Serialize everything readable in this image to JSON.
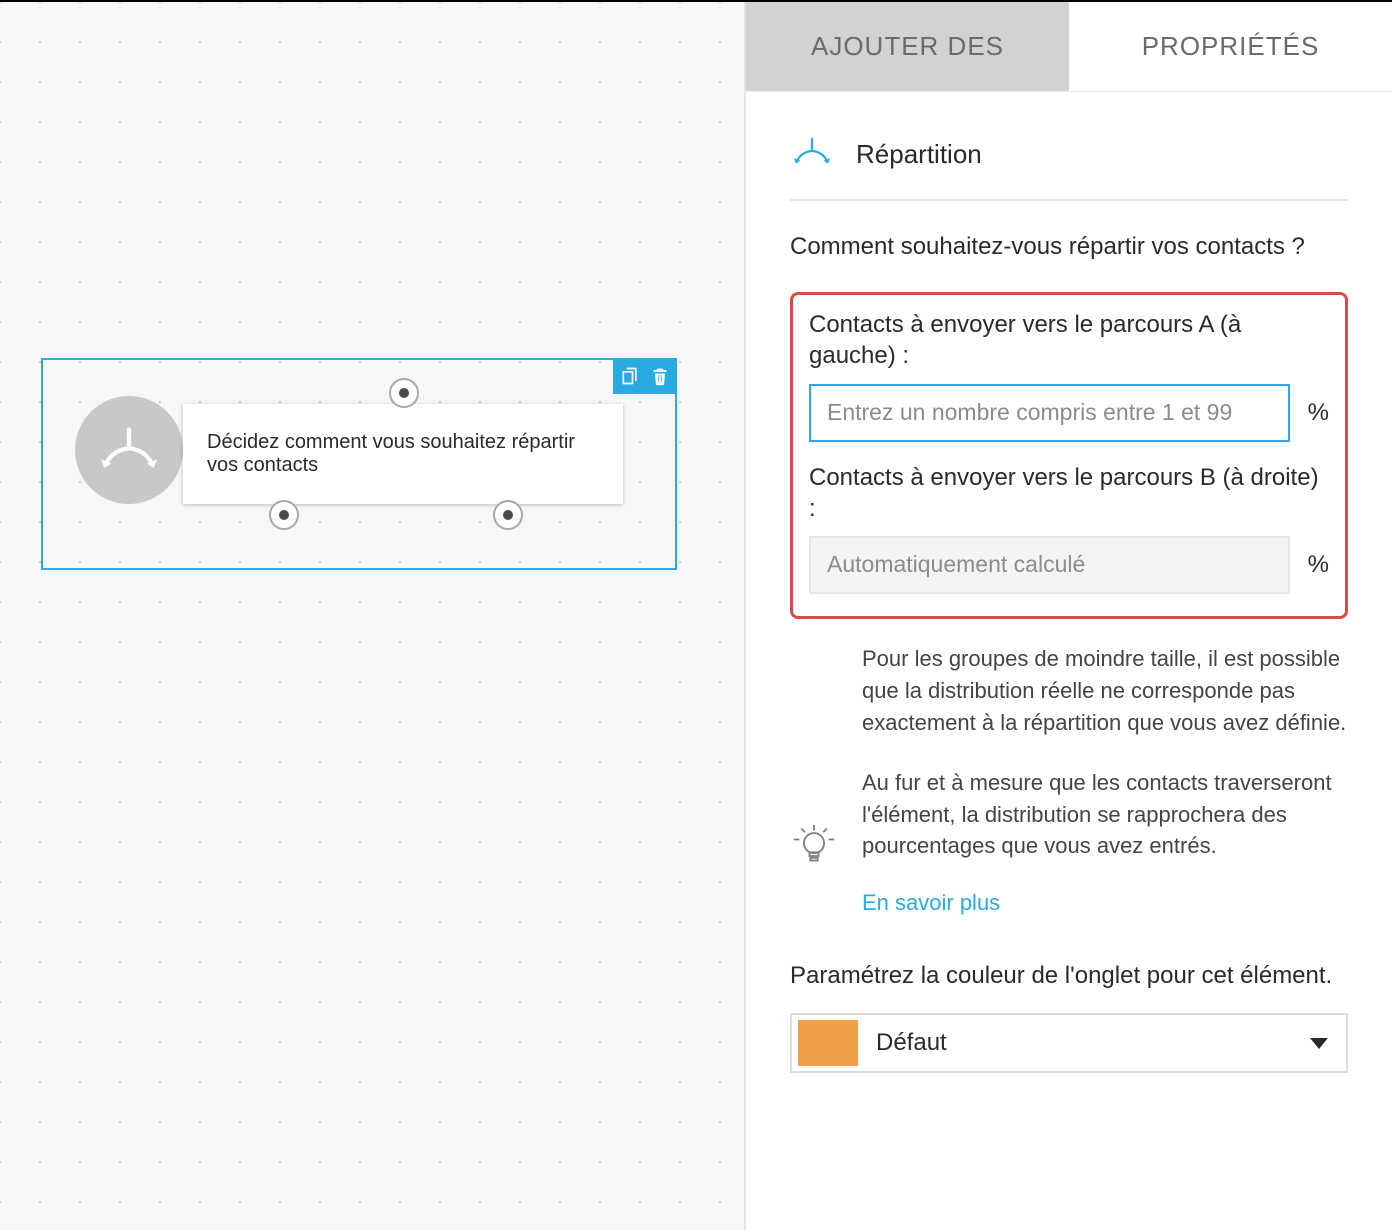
{
  "tabs": {
    "add": "AJOUTER DES",
    "properties": "PROPRIÉTÉS"
  },
  "canvas": {
    "node_text": "Décidez comment vous souhaitez répartir vos contacts"
  },
  "panel": {
    "title": "Répartition",
    "question": "Comment souhaitez-vous répartir vos contacts ?",
    "path_a_label": "Contacts à envoyer vers le parcours A (à gauche) :",
    "path_a_placeholder": "Entrez un nombre compris entre 1 et 99",
    "path_b_label": "Contacts à envoyer vers le parcours B (à droite) :",
    "path_b_placeholder": "Automatiquement calculé",
    "pct": "%"
  },
  "info": {
    "p1": "Pour les groupes de moindre taille, il est possible que la distribution réelle ne corresponde pas exactement à la répartition que vous avez définie.",
    "p2": "Au fur et à mesure que les contacts traverseront l'élément, la distribution se rapprochera des pourcentages que vous avez entrés.",
    "link": "En savoir plus"
  },
  "color": {
    "label": "Paramétrez la couleur de l'onglet pour cet élément.",
    "value": "Défaut",
    "swatch": "#f0a048"
  }
}
